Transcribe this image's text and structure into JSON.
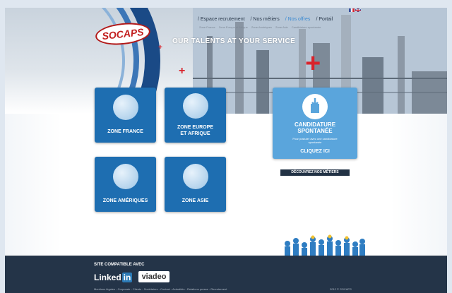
{
  "brand": {
    "logo_text": "SOCAPS",
    "tagline": "OUR TALENTS AT YOUR SERVICE"
  },
  "nav": {
    "items": [
      {
        "label": "/ Espace recrutement",
        "active": false
      },
      {
        "label": "/ Nos métiers",
        "active": false
      },
      {
        "label": "/ Nos offres",
        "active": true
      },
      {
        "label": "/ Portail",
        "active": false
      }
    ],
    "subitems": [
      "Zone France",
      "Zone Europe et Afrique",
      "Zone Amériques",
      "Zone Asie",
      "Candidature spontanée"
    ],
    "languages": [
      "fr-flag-icon",
      "en-flag-icon"
    ]
  },
  "zones": [
    {
      "label": "ZONE FRANCE",
      "icon": "globe-europe-icon"
    },
    {
      "label": "ZONE EUROPE ET AFRIQUE",
      "icon": "globe-africa-icon"
    },
    {
      "label": "ZONE AMÉRIQUES",
      "icon": "globe-americas-icon"
    },
    {
      "label": "ZONE ASIE",
      "icon": "globe-asia-icon"
    }
  ],
  "candidature": {
    "title_line1": "CANDIDATURE",
    "title_line2": "SPONTANÉE",
    "description": "Pour postuler avec une candidature spontanée",
    "cta": "CLIQUEZ ICI",
    "icon": "document-download-icon"
  },
  "metiers_button": "DÉCOUVREZ NOS MÉTIERS",
  "footer": {
    "compat_label": "SITE COMPATIBLE AVEC",
    "linkedin_text": "Linked",
    "linkedin_in": "in",
    "viadeo": "viadeo",
    "links": "Mentions légales - Corporate - Clients - Sociétaires - Contact - Actualités - Relations presse - Recrutement",
    "copyright": "2012 © SOCAPS"
  },
  "colors": {
    "tile_blue": "#1e6eb1",
    "cta_blue": "#5aa5dc",
    "accent_red": "#d9232b",
    "footer_bg": "#243448"
  }
}
